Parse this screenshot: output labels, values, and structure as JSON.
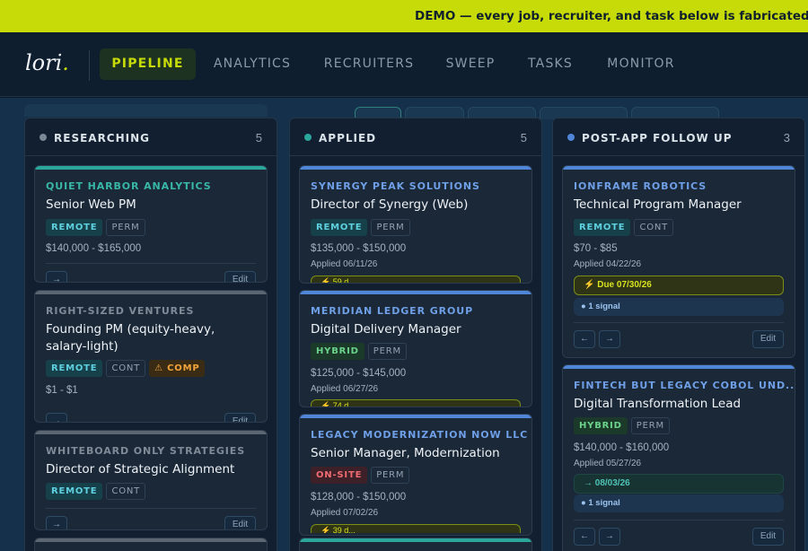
{
  "banner": {
    "text": "DEMO — every job, recruiter, and task below is fabricated (son"
  },
  "nav": {
    "logo": "lori",
    "logo_dot": ".",
    "tabs": [
      {
        "label": "PIPELINE",
        "active": true
      },
      {
        "label": "ANALYTICS"
      },
      {
        "label": "RECRUITERS"
      },
      {
        "label": "SWEEP"
      },
      {
        "label": "TASKS"
      },
      {
        "label": "MONITOR"
      }
    ]
  },
  "colors": {
    "accent": "#c6db08",
    "teal": "#2aa79a",
    "blue": "#4f86d8",
    "gray": "#5b6672"
  },
  "columns": [
    {
      "title": "RESEARCHING",
      "count": "5",
      "dot_color": "#7a8794",
      "cards": [
        {
          "company": "QUIET HARBOR ANALYTICS",
          "title": "Senior Web PM",
          "tags": [
            "REMOTE",
            "PERM"
          ],
          "salary": "$140,000 - $165,000",
          "edit": "Edit",
          "nav_btn": "→"
        },
        {
          "company": "RIGHT-SIZED VENTURES",
          "title": "Founding PM (equity-heavy, salary-light)",
          "tags": [
            "REMOTE",
            "CONT",
            "⚠ COMP"
          ],
          "salary": "$1 - $1",
          "edit": "Edit",
          "nav_btn": "→"
        },
        {
          "company": "WHITEBOARD ONLY STRATEGIES",
          "title": "Director of Strategic Alignment",
          "tags": [
            "REMOTE",
            "CONT"
          ],
          "edit": "Edit",
          "nav_btn": "→"
        }
      ]
    },
    {
      "title": "APPLIED",
      "count": "5",
      "dot_color": "#2aa79a",
      "cards": [
        {
          "company": "SYNERGY PEAK SOLUTIONS",
          "title": "Director of Synergy (Web)",
          "tags": [
            "REMOTE",
            "PERM"
          ],
          "salary": "$135,000 - $150,000",
          "applied": "Applied 06/11/26",
          "peek": "⚡ 59 d..."
        },
        {
          "company": "MERIDIAN LEDGER GROUP",
          "title": "Digital Delivery Manager",
          "tags": [
            "HYBRID",
            "PERM"
          ],
          "salary": "$125,000 - $145,000",
          "applied": "Applied 06/27/26",
          "peek": "⚡ 74 d..."
        },
        {
          "company": "LEGACY MODERNIZATION NOW LLC",
          "title": "Senior Manager, Modernization",
          "tags": [
            "ON-SITE",
            "PERM"
          ],
          "salary": "$128,000 - $150,000",
          "applied": "Applied 07/02/26",
          "peek": "⚡ 39 d..."
        }
      ]
    },
    {
      "title": "POST-APP FOLLOW UP",
      "count": "3",
      "dot_color": "#4f86d8",
      "cards": [
        {
          "company": "IONFRAME ROBOTICS",
          "title": "Technical Program Manager",
          "tags": [
            "REMOTE",
            "CONT"
          ],
          "salary": "$70 - $85",
          "applied": "Applied 04/22/26",
          "due": "⚡ Due 07/30/26",
          "signal": "● 1 signal",
          "back_btn": "←",
          "fwd_btn": "→",
          "edit": "Edit"
        },
        {
          "company": "FINTECH BUT LEGACY COBOL UND...",
          "title": "Digital Transformation Lead",
          "tags": [
            "HYBRID",
            "PERM"
          ],
          "salary": "$140,000 - $160,000",
          "applied": "Applied 05/27/26",
          "due": "→ 08/03/26",
          "signal": "● 1 signal",
          "back_btn": "←",
          "fwd_btn": "→",
          "edit": "Edit"
        }
      ]
    }
  ]
}
